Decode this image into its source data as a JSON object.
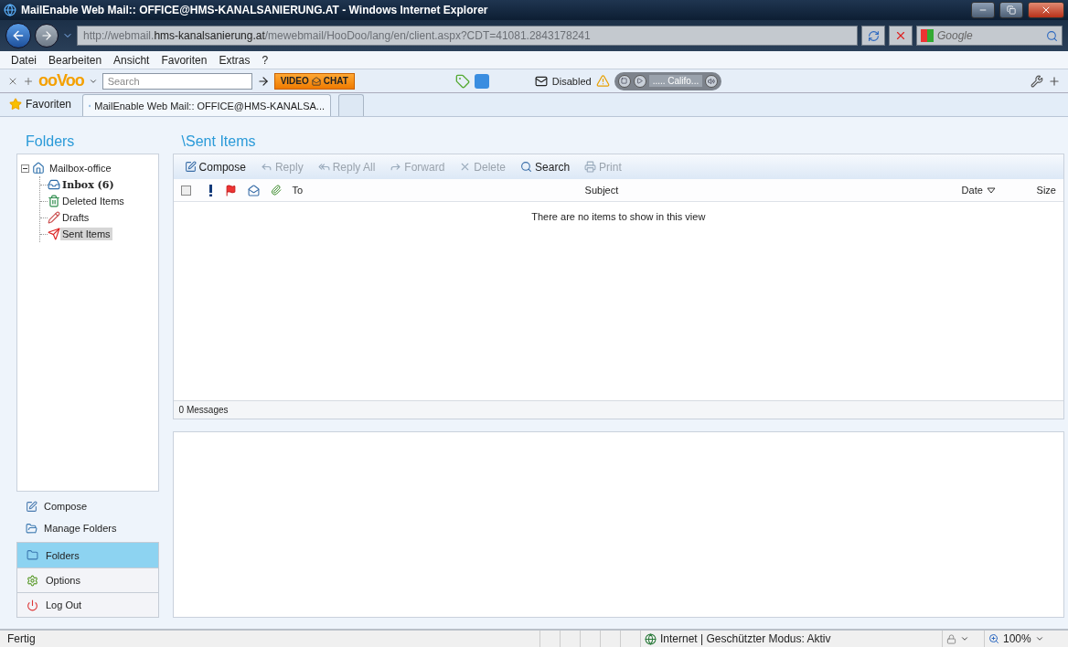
{
  "window": {
    "title": "MailEnable Web Mail:: OFFICE@HMS-KANALSANIERUNG.AT - Windows Internet Explorer"
  },
  "address_bar": {
    "url": "http://webmail.**hms-kanalsanierung.at**/mewebmail/HooDoo/lang/en/client.aspx?CDT=41081.2843178241",
    "search_placeholder": "Google"
  },
  "menu": [
    "Datei",
    "Bearbeiten",
    "Ansicht",
    "Favoriten",
    "Extras",
    "?"
  ],
  "toolbar": {
    "logo": "ooVoo",
    "search_placeholder": "Search",
    "video_chat": [
      "VIDEO",
      "CHAT"
    ],
    "popup_status": "Disabled",
    "radio_station": "..... Califo..."
  },
  "favorites_bar": {
    "favorites": "Favoriten",
    "tabs": [
      {
        "label": "MailEnable Web Mail:: OFFICE@HMS-KANALSA...",
        "selected": true
      }
    ]
  },
  "folders": {
    "title": "Folders",
    "tree": {
      "label": "Mailbox-office",
      "expanded": true,
      "children": [
        {
          "kind": "inbox",
          "label": "Inbox (6)",
          "unread": true,
          "selected": false
        },
        {
          "kind": "deleted",
          "label": "Deleted Items",
          "unread": false,
          "selected": false
        },
        {
          "kind": "drafts",
          "label": "Drafts",
          "unread": false,
          "selected": false
        },
        {
          "kind": "sent",
          "label": "Sent Items",
          "unread": false,
          "selected": true
        }
      ]
    }
  },
  "message_list": {
    "title": "\\Sent Items",
    "actions": [
      {
        "kind": "compose",
        "label": "Compose",
        "disabled": false
      },
      {
        "kind": "reply",
        "label": "Reply",
        "disabled": true
      },
      {
        "kind": "reply_all",
        "label": "Reply All",
        "disabled": true
      },
      {
        "kind": "forward",
        "label": "Forward",
        "disabled": true
      },
      {
        "kind": "delete",
        "label": "Delete",
        "disabled": true
      },
      {
        "kind": "search",
        "label": "Search",
        "disabled": false
      },
      {
        "kind": "print",
        "label": "Print",
        "disabled": true
      }
    ],
    "select_all_checked": false,
    "columns": [
      {
        "label": "To",
        "sorted": false
      },
      {
        "label": "Subject",
        "sorted": false
      },
      {
        "label": "Date",
        "sorted": true
      },
      {
        "label": "Size",
        "sorted": false
      }
    ],
    "empty_text": "There are no items to show in this view",
    "count": "0 Messages"
  },
  "nav_links": [
    {
      "kind": "compose",
      "label": "Compose"
    },
    {
      "kind": "manage",
      "label": "Manage Folders"
    }
  ],
  "nav_items": [
    {
      "kind": "folders",
      "label": "Folders",
      "selected": true
    },
    {
      "kind": "options",
      "label": "Options",
      "selected": false
    },
    {
      "kind": "logout",
      "label": "Log Out",
      "selected": false
    }
  ],
  "status_bar": {
    "status": "Fertig",
    "zone": "Internet | Geschützter Modus: Aktiv",
    "zoom": "100%"
  }
}
